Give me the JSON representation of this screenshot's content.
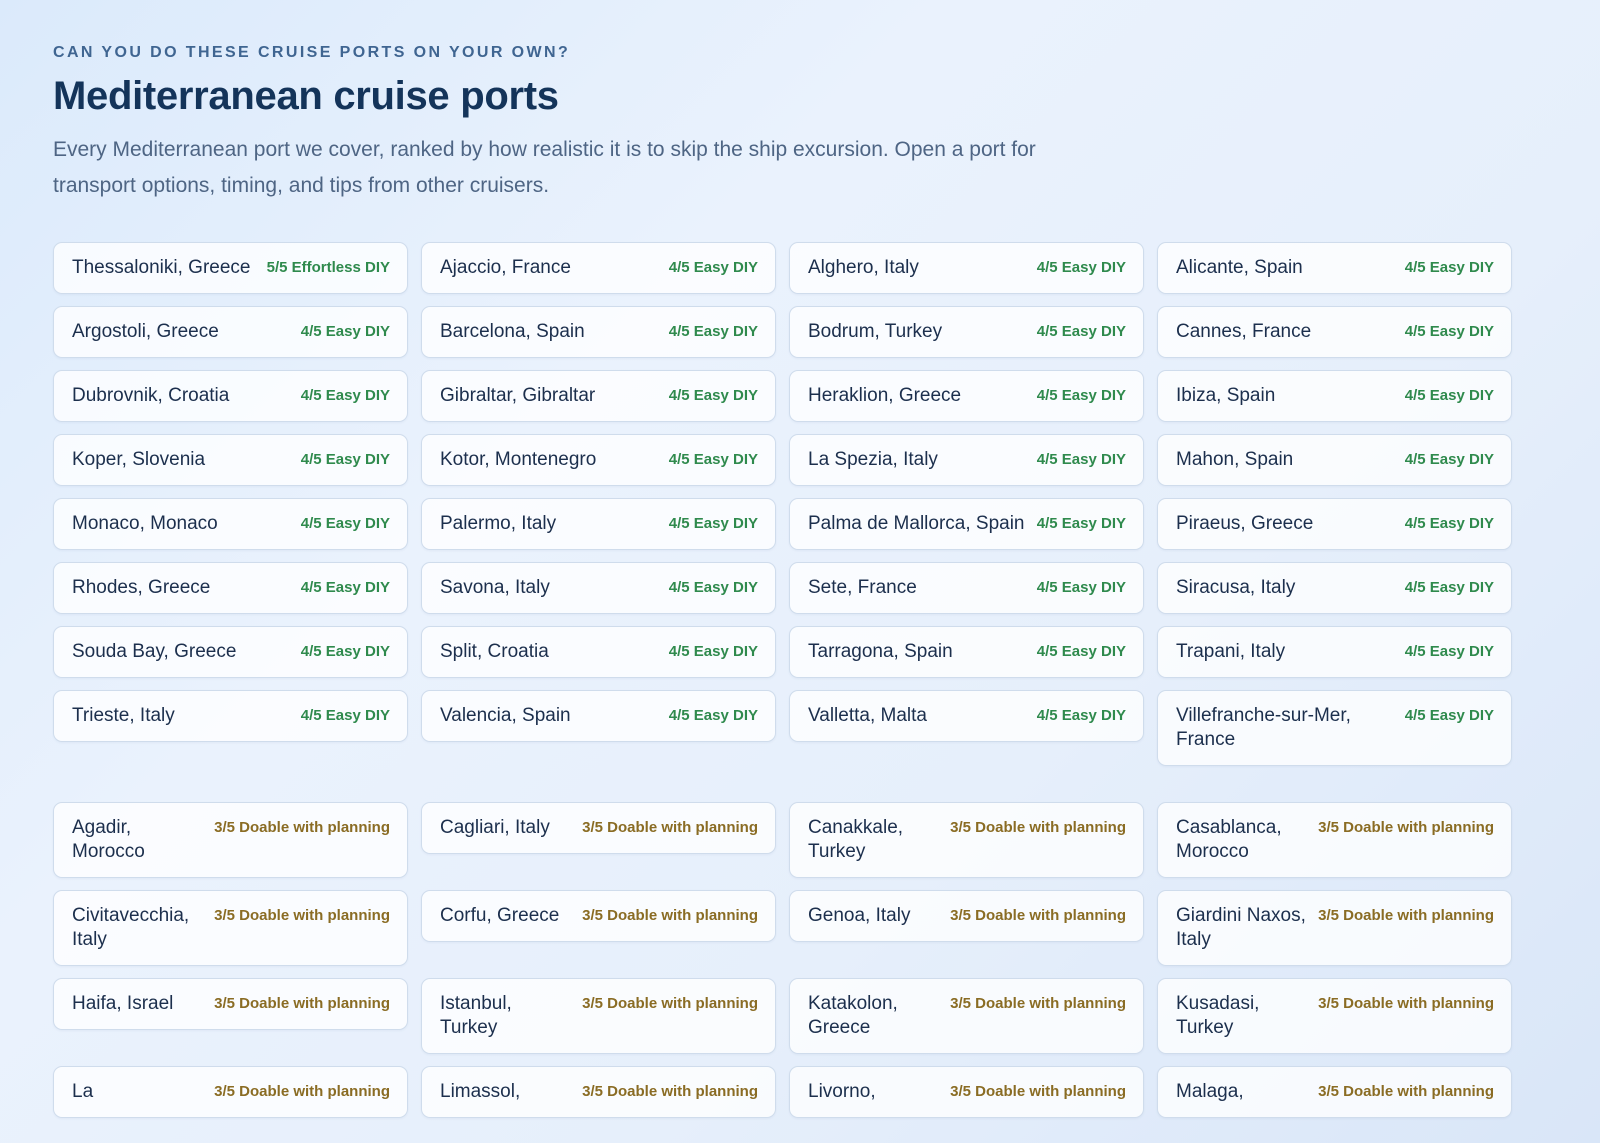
{
  "header": {
    "eyebrow": "CAN YOU DO THESE CRUISE PORTS ON YOUR OWN?",
    "title": "Mediterranean cruise ports",
    "intro": "Every Mediterranean port we cover, ranked by how realistic it is to skip the ship excursion. Open a port for transport options, timing, and tips from other cruisers."
  },
  "colors": {
    "easy": "#2f8a4d",
    "doable": "#8a6c24",
    "title": "#14345a"
  },
  "ports": [
    {
      "name": "Thessaloniki, Greece",
      "rating": "5/5 Effortless DIY",
      "level": 5
    },
    {
      "name": "Ajaccio, France",
      "rating": "4/5 Easy DIY",
      "level": 4
    },
    {
      "name": "Alghero, Italy",
      "rating": "4/5 Easy DIY",
      "level": 4
    },
    {
      "name": "Alicante, Spain",
      "rating": "4/5 Easy DIY",
      "level": 4
    },
    {
      "name": "Argostoli, Greece",
      "rating": "4/5 Easy DIY",
      "level": 4
    },
    {
      "name": "Barcelona, Spain",
      "rating": "4/5 Easy DIY",
      "level": 4
    },
    {
      "name": "Bodrum, Turkey",
      "rating": "4/5 Easy DIY",
      "level": 4
    },
    {
      "name": "Cannes, France",
      "rating": "4/5 Easy DIY",
      "level": 4
    },
    {
      "name": "Dubrovnik, Croatia",
      "rating": "4/5 Easy DIY",
      "level": 4
    },
    {
      "name": "Gibraltar, Gibraltar",
      "rating": "4/5 Easy DIY",
      "level": 4
    },
    {
      "name": "Heraklion, Greece",
      "rating": "4/5 Easy DIY",
      "level": 4
    },
    {
      "name": "Ibiza, Spain",
      "rating": "4/5 Easy DIY",
      "level": 4
    },
    {
      "name": "Koper, Slovenia",
      "rating": "4/5 Easy DIY",
      "level": 4
    },
    {
      "name": "Kotor, Montenegro",
      "rating": "4/5 Easy DIY",
      "level": 4
    },
    {
      "name": "La Spezia, Italy",
      "rating": "4/5 Easy DIY",
      "level": 4
    },
    {
      "name": "Mahon, Spain",
      "rating": "4/5 Easy DIY",
      "level": 4
    },
    {
      "name": "Monaco, Monaco",
      "rating": "4/5 Easy DIY",
      "level": 4
    },
    {
      "name": "Palermo, Italy",
      "rating": "4/5 Easy DIY",
      "level": 4
    },
    {
      "name": "Palma de Mallorca, Spain",
      "rating": "4/5 Easy DIY",
      "level": 4
    },
    {
      "name": "Piraeus, Greece",
      "rating": "4/5 Easy DIY",
      "level": 4
    },
    {
      "name": "Rhodes, Greece",
      "rating": "4/5 Easy DIY",
      "level": 4
    },
    {
      "name": "Savona, Italy",
      "rating": "4/5 Easy DIY",
      "level": 4
    },
    {
      "name": "Sete, France",
      "rating": "4/5 Easy DIY",
      "level": 4
    },
    {
      "name": "Siracusa, Italy",
      "rating": "4/5 Easy DIY",
      "level": 4
    },
    {
      "name": "Souda Bay, Greece",
      "rating": "4/5 Easy DIY",
      "level": 4
    },
    {
      "name": "Split, Croatia",
      "rating": "4/5 Easy DIY",
      "level": 4
    },
    {
      "name": "Tarragona, Spain",
      "rating": "4/5 Easy DIY",
      "level": 4
    },
    {
      "name": "Trapani, Italy",
      "rating": "4/5 Easy DIY",
      "level": 4
    },
    {
      "name": "Trieste, Italy",
      "rating": "4/5 Easy DIY",
      "level": 4
    },
    {
      "name": "Valencia, Spain",
      "rating": "4/5 Easy DIY",
      "level": 4
    },
    {
      "name": "Valletta, Malta",
      "rating": "4/5 Easy DIY",
      "level": 4
    },
    {
      "name": "Villefranche-sur-Mer, France",
      "rating": "4/5 Easy DIY",
      "level": 4
    },
    {
      "name": "Agadir, Morocco",
      "rating": "3/5 Doable with planning",
      "level": 3
    },
    {
      "name": "Cagliari, Italy",
      "rating": "3/5 Doable with planning",
      "level": 3
    },
    {
      "name": "Canakkale, Turkey",
      "rating": "3/5 Doable with planning",
      "level": 3
    },
    {
      "name": "Casablanca, Morocco",
      "rating": "3/5 Doable with planning",
      "level": 3
    },
    {
      "name": "Civitavecchia, Italy",
      "rating": "3/5 Doable with planning",
      "level": 3
    },
    {
      "name": "Corfu, Greece",
      "rating": "3/5 Doable with planning",
      "level": 3
    },
    {
      "name": "Genoa, Italy",
      "rating": "3/5 Doable with planning",
      "level": 3
    },
    {
      "name": "Giardini Naxos, Italy",
      "rating": "3/5 Doable with planning",
      "level": 3
    },
    {
      "name": "Haifa, Israel",
      "rating": "3/5 Doable with planning",
      "level": 3
    },
    {
      "name": "Istanbul, Turkey",
      "rating": "3/5 Doable with planning",
      "level": 3
    },
    {
      "name": "Katakolon, Greece",
      "rating": "3/5 Doable with planning",
      "level": 3
    },
    {
      "name": "Kusadasi, Turkey",
      "rating": "3/5 Doable with planning",
      "level": 3
    },
    {
      "name": "La",
      "rating": "3/5 Doable with planning",
      "level": 3
    },
    {
      "name": "Limassol,",
      "rating": "3/5 Doable with planning",
      "level": 3
    },
    {
      "name": "Livorno,",
      "rating": "3/5 Doable with planning",
      "level": 3
    },
    {
      "name": "Malaga,",
      "rating": "3/5 Doable with planning",
      "level": 3
    }
  ]
}
